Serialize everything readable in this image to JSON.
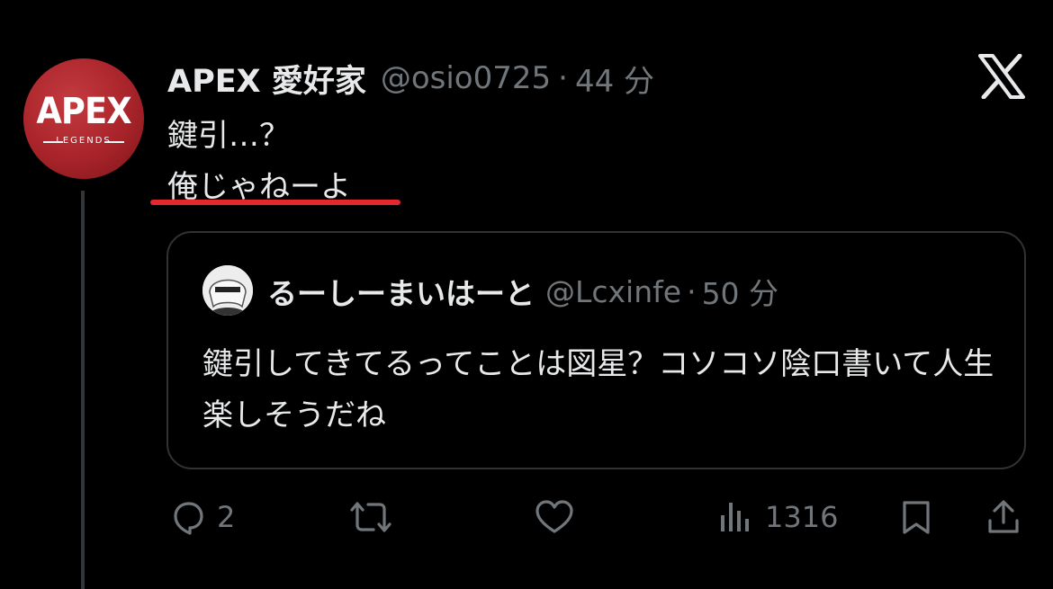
{
  "tweet": {
    "avatar_logo": "APEX",
    "avatar_sub": "LEGENDS",
    "display_name": "APEX 愛好家",
    "handle": "@osio0725",
    "separator": "·",
    "time": "44 分",
    "line1": "鍵引…？",
    "line2": "俺じゃねーよ",
    "underline_color": "#e5282e"
  },
  "quote": {
    "display_name": "るーしーまいはーと",
    "handle": "@Lcxinfe",
    "separator": "·",
    "time": "50 分",
    "text": "鍵引してきてるってことは図星？コソコソ陰口書いて人生楽しそうだね"
  },
  "actions": {
    "reply_count": "2",
    "views_count": "1316"
  },
  "colors": {
    "background": "#000000",
    "text": "#e7e9ea",
    "muted": "#71767b",
    "border": "#2f3336",
    "avatar_red": "#a8242a"
  },
  "icons": [
    "x-logo-icon",
    "reply-icon",
    "retweet-icon",
    "like-icon",
    "views-icon",
    "bookmark-icon",
    "share-icon"
  ]
}
